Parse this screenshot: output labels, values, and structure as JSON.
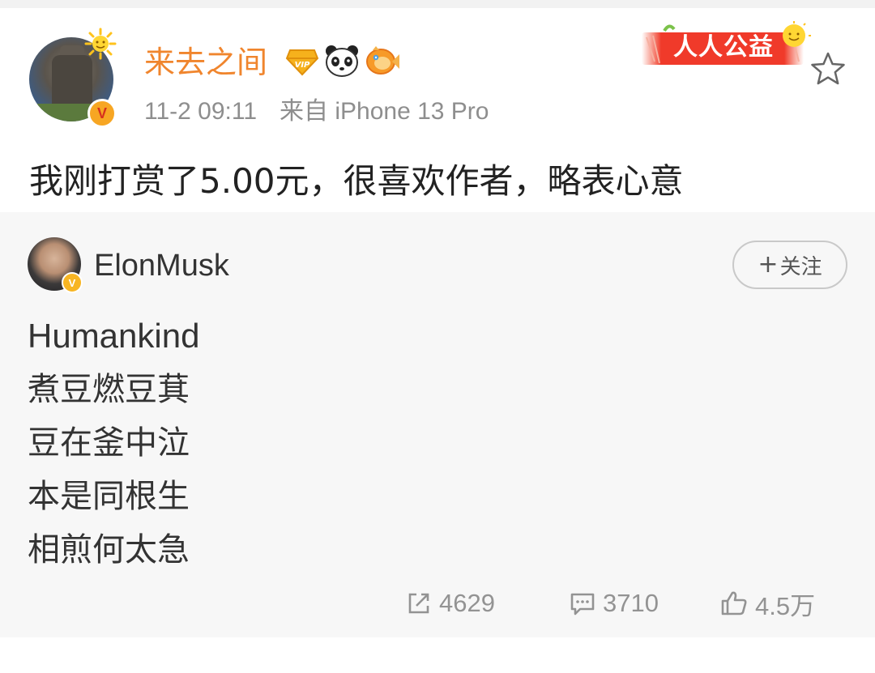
{
  "post": {
    "author": "来去之间",
    "time": "11-2 09:11",
    "source": "来自 iPhone 13 Pro",
    "text": "我刚打赏了5.00元，很喜欢作者，略表心意",
    "badges": [
      "vip-icon",
      "panda-icon",
      "fish-icon"
    ],
    "charity_label": "人人公益",
    "verified_label": "V"
  },
  "repost": {
    "author": "ElonMusk",
    "verified_label": "V",
    "follow_label": "关注",
    "lines": [
      "Humankind",
      "煮豆燃豆萁",
      "豆在釜中泣",
      "本是同根生",
      "相煎何太急"
    ]
  },
  "actions": {
    "share_count": "4629",
    "comment_count": "3710",
    "like_count": "4.5万"
  },
  "colors": {
    "username": "#f0852d",
    "meta": "#8e8e8e",
    "text": "#222222",
    "repost_bg": "#f7f7f7",
    "action": "#939393"
  }
}
